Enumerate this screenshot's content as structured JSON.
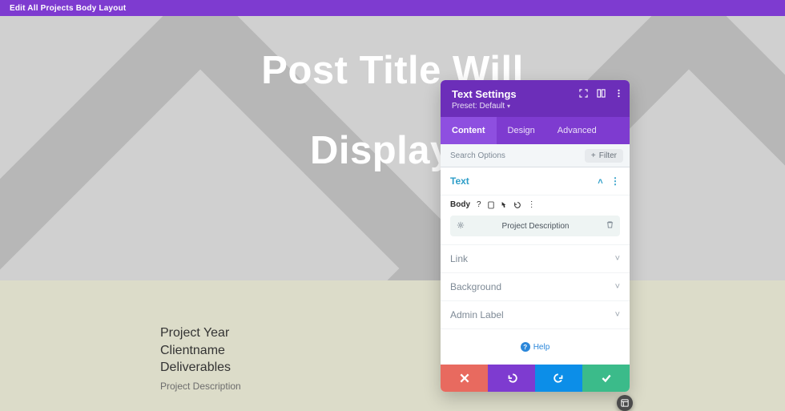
{
  "topbar": {
    "title": "Edit All Projects Body Layout"
  },
  "hero": {
    "line1": "Post Title Will",
    "line2": "Display I"
  },
  "meta": {
    "year": "Project Year",
    "client": "Clientname",
    "deliverables": "Deliverables",
    "description": "Project Description"
  },
  "panel": {
    "title": "Text Settings",
    "preset_label": "Preset:",
    "preset_value": "Default",
    "tabs": {
      "content": "Content",
      "design": "Design",
      "advanced": "Advanced"
    },
    "search_placeholder": "Search Options",
    "filter_label": "Filter",
    "sections": {
      "text": "Text",
      "link": "Link",
      "background": "Background",
      "admin_label": "Admin Label"
    },
    "body_label": "Body",
    "dynamic_value": "Project Description",
    "help": "Help"
  }
}
